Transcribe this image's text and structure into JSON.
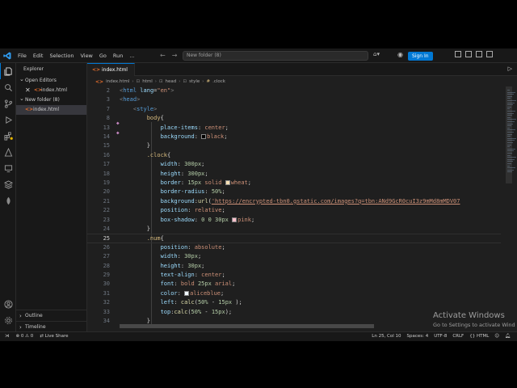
{
  "menu": [
    "File",
    "Edit",
    "Selection",
    "View",
    "Go",
    "Run"
  ],
  "more_menu": "...",
  "command_center": "New folder (8)",
  "sign_in": "Sign In",
  "explorer": {
    "title": "Explorer",
    "open_editors_label": "Open Editors",
    "open_editor_file": "index.html",
    "folder_label": "New folder (8)",
    "folder_file": "index.html",
    "outline_label": "Outline",
    "timeline_label": "Timeline"
  },
  "tab": {
    "label": "index.html"
  },
  "breadcrumb": [
    "index.html",
    "html",
    "head",
    "style",
    ".clock"
  ],
  "code_lines": [
    {
      "num": "2",
      "html": "<span class=\"t-punc\">&lt;</span><span class=\"t-tag\">html</span> <span class=\"t-attr\">lang</span>=<span class=\"t-str\">\"en\"</span><span class=\"t-punc\">&gt;</span>",
      "indent": 0
    },
    {
      "num": "3",
      "html": "<span class=\"t-punc\">&lt;</span><span class=\"t-tag\">head</span><span class=\"t-punc\">&gt;</span>",
      "indent": 0
    },
    {
      "num": "7",
      "html": "    <span class=\"t-punc\">&lt;</span><span class=\"t-tag\">style</span><span class=\"t-punc\">&gt;</span>",
      "indent": 0
    },
    {
      "num": "8",
      "html": "        <span class=\"t-sel\">body</span>{",
      "indent": 0
    },
    {
      "num": "13",
      "html": "            <span class=\"t-prop\">place-items</span>: <span class=\"t-val\">center</span>;",
      "indent": 0
    },
    {
      "num": "14",
      "html": "            <span class=\"t-prop\">background</span>: <span class=\"swatch\" style=\"background:#000\"></span><span class=\"t-val\">black</span>;",
      "indent": 0
    },
    {
      "num": "15",
      "html": "        }",
      "indent": 0
    },
    {
      "num": "16",
      "html": "        <span class=\"t-sel\">.clock</span>{",
      "indent": 0
    },
    {
      "num": "17",
      "html": "            <span class=\"t-prop\">width</span>: <span class=\"t-num\">300px</span>;",
      "indent": 0
    },
    {
      "num": "18",
      "html": "            <span class=\"t-prop\">height</span>: <span class=\"t-num\">300px</span>;",
      "indent": 0
    },
    {
      "num": "19",
      "html": "            <span class=\"t-prop\">border</span>: <span class=\"t-num\">15px</span> <span class=\"t-val\">solid</span> <span class=\"swatch\" style=\"background:#f5deb3\"></span><span class=\"t-val\">wheat</span>;",
      "indent": 0
    },
    {
      "num": "20",
      "html": "            <span class=\"t-prop\">border-radius</span>: <span class=\"t-num\">50%</span>;",
      "indent": 0
    },
    {
      "num": "21",
      "html": "            <span class=\"t-prop\">background</span>:<span class=\"t-fn\">url</span>(<span class=\"t-url\">'https://encrypted-tbn0.gstatic.com/images?q=tbn:ANd9GcR0cuI3z9mMd8mMDV07</span>",
      "indent": 0
    },
    {
      "num": "22",
      "html": "            <span class=\"t-prop\">position</span>: <span class=\"t-val\">relative</span>;",
      "indent": 0
    },
    {
      "num": "23",
      "html": "            <span class=\"t-prop\">box-shadow</span>: <span class=\"t-num\">0 0 30px</span> <span class=\"swatch\" style=\"background:#ffc0cb\"></span><span class=\"t-val\">pink</span>;",
      "indent": 0
    },
    {
      "num": "24",
      "html": "        }",
      "indent": 0
    },
    {
      "num": "25",
      "html": "        <span class=\"t-sel\">.num</span>{",
      "indent": 0
    },
    {
      "num": "26",
      "html": "            <span class=\"t-prop\">position</span>: <span class=\"t-val\">absolute</span>;",
      "indent": 0
    },
    {
      "num": "27",
      "html": "            <span class=\"t-prop\">width</span>: <span class=\"t-num\">30px</span>;",
      "indent": 0
    },
    {
      "num": "28",
      "html": "            <span class=\"t-prop\">height</span>: <span class=\"t-num\">30px</span>;",
      "indent": 0
    },
    {
      "num": "29",
      "html": "            <span class=\"t-prop\">text-align</span>: <span class=\"t-val\">center</span>;",
      "indent": 0
    },
    {
      "num": "30",
      "html": "            <span class=\"t-prop\">font</span>: <span class=\"t-val\">bold</span> <span class=\"t-num\">25px</span> <span class=\"t-val\">arial</span>;",
      "indent": 0
    },
    {
      "num": "31",
      "html": "            <span class=\"t-prop\">color</span>: <span class=\"swatch\" style=\"background:#f0f8ff\"></span><span class=\"t-val\">aliceblue</span>;",
      "indent": 0
    },
    {
      "num": "32",
      "html": "            <span class=\"t-prop\">left</span>: <span class=\"t-fn\">calc</span>(<span class=\"t-num\">50%</span> - <span class=\"t-num\">15px</span> );",
      "indent": 0
    },
    {
      "num": "33",
      "html": "            <span class=\"t-prop\">top</span>:<span class=\"t-fn\">calc</span>(<span class=\"t-num\">50%</span> - <span class=\"t-num\">15px</span>);",
      "indent": 0
    },
    {
      "num": "34",
      "html": "        }",
      "indent": 0
    }
  ],
  "current_line": "25",
  "status": {
    "errors": "0",
    "warnings": "0",
    "live_share": "Live Share",
    "position": "Ln 25, Col 10",
    "spaces": "Spaces: 4",
    "encoding": "UTF-8",
    "eol": "CRLF",
    "language": "HTML"
  },
  "watermark": {
    "title": "Activate Windows",
    "subtitle": "Go to Settings to activate Wind"
  },
  "colors": {
    "accent": "#0078d4",
    "editor_bg": "#1f1f1f",
    "sidebar_bg": "#181818"
  }
}
